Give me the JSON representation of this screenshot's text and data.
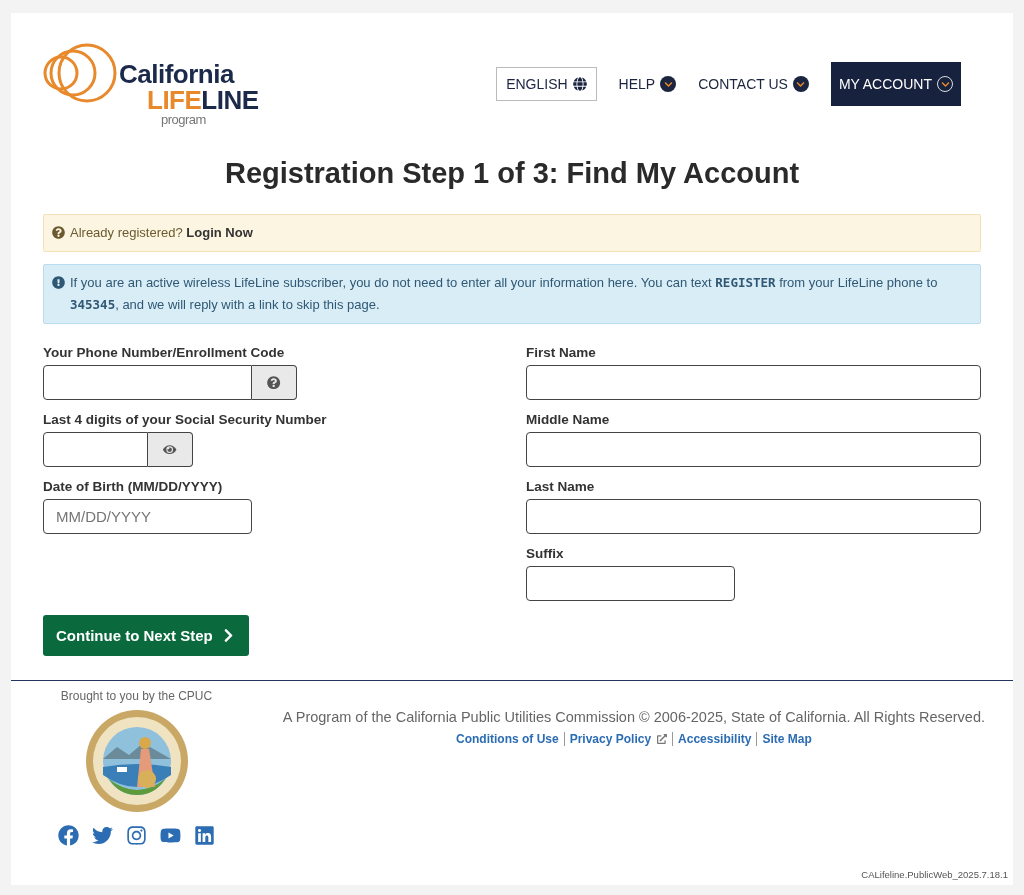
{
  "logo": {
    "top": "California",
    "life": "LIFE",
    "line": "LINE",
    "tagline": "program"
  },
  "nav": [
    {
      "label": "ENGLISH",
      "kind": "language"
    },
    {
      "label": "HELP",
      "kind": "menu"
    },
    {
      "label": "CONTACT US",
      "kind": "menu"
    },
    {
      "label": "MY ACCOUNT",
      "kind": "account"
    }
  ],
  "title": "Registration Step 1 of 3: Find My Account",
  "alerts": [
    {
      "kind": "warning",
      "text": "Already registered?",
      "link": "Login Now"
    },
    {
      "kind": "info",
      "text": "If you are an active wireless LifeLine subscriber, you do not need to enter all your information here. You can text **REGISTER** from your LifeLine phone to **345345**, and we will reply with a link to skip this page."
    }
  ],
  "left_fields": [
    {
      "label": "Your Phone Number/Enrollment Code",
      "kind": "help"
    },
    {
      "label": "Last 4 digits of your Social Security Number",
      "kind": "reveal"
    },
    {
      "label": "Date of Birth (MM/DD/YYYY)",
      "kind": "date",
      "placeholder": "MM/DD/YYYY"
    }
  ],
  "right_fields": [
    {
      "label": "First Name",
      "kind": "text"
    },
    {
      "label": "Middle Name",
      "kind": "text"
    },
    {
      "label": "Last Name",
      "kind": "text"
    },
    {
      "label": "Suffix",
      "kind": "short"
    }
  ],
  "continue_button": "Continue to Next Step",
  "footer": {
    "brought_by": "Brought to you by the CPUC",
    "copyright": "A Program of the California Public Utilities Commission © 2006-2025, State of California. All Rights Reserved.",
    "links": [
      {
        "label": "Conditions of Use",
        "external": false
      },
      {
        "label": "Privacy Policy",
        "external": true
      },
      {
        "label": "Accessibility",
        "external": false
      },
      {
        "label": "Site Map",
        "external": false
      }
    ],
    "version": "CALifeline.PublicWeb_2025.7.18.1"
  }
}
